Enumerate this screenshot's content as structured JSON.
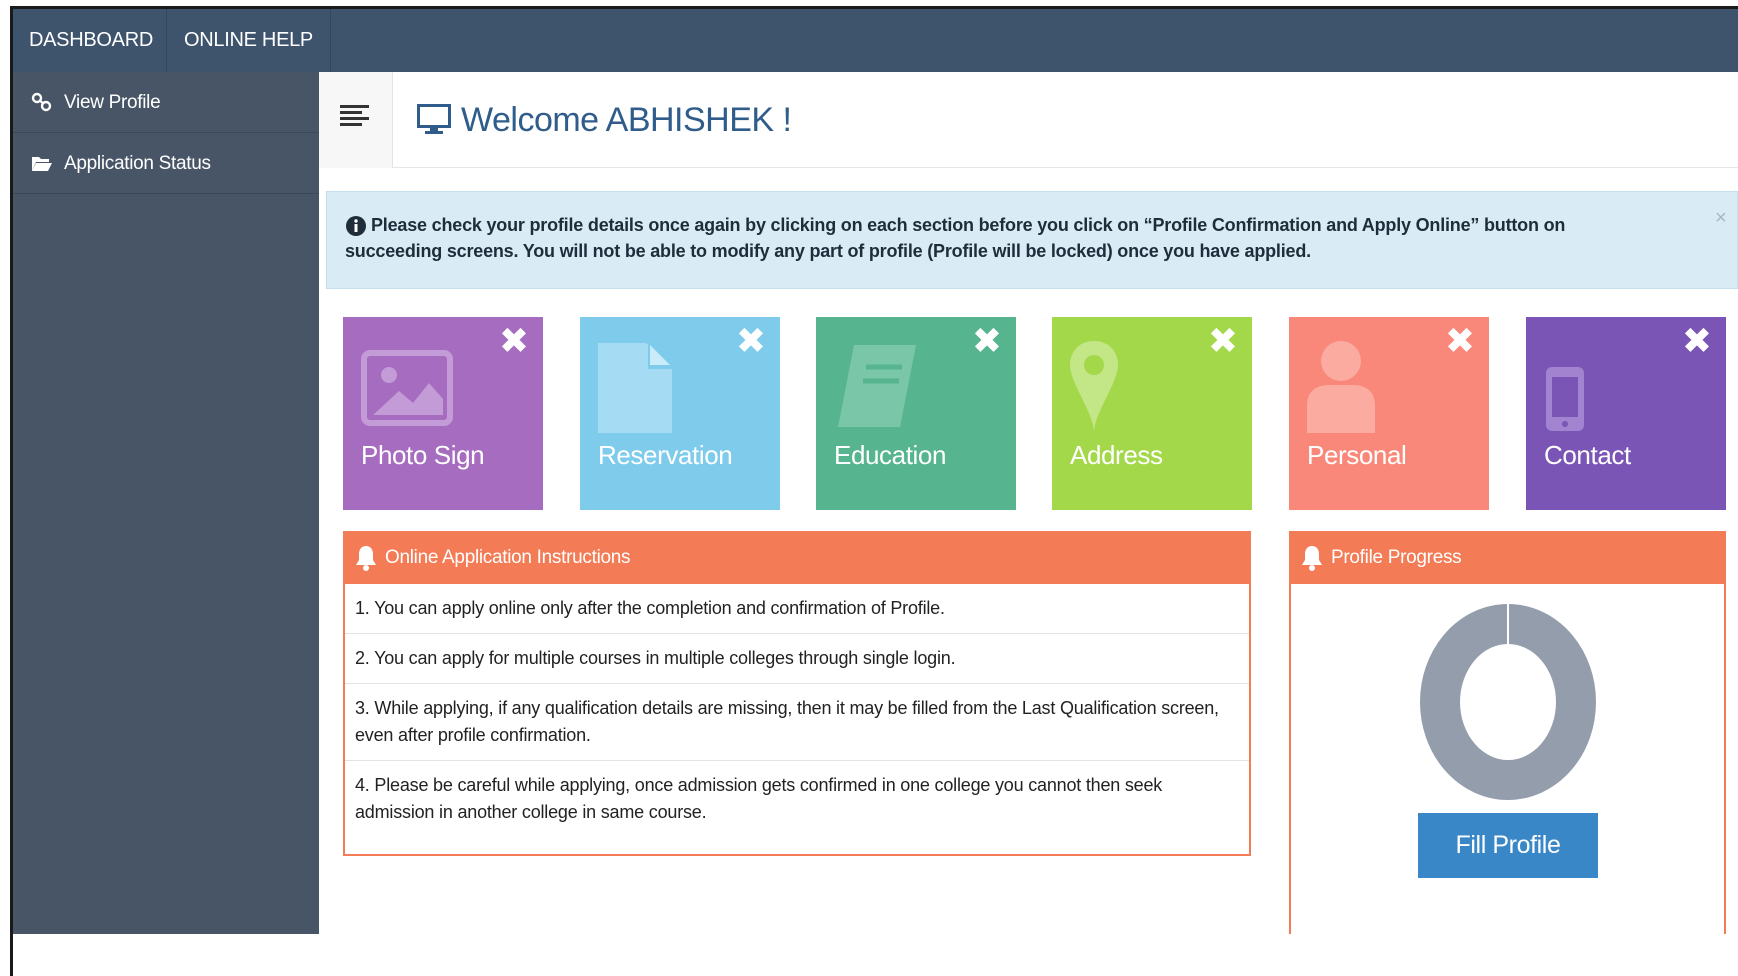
{
  "topnav": {
    "dashboard": "DASHBOARD",
    "online_help": "ONLINE HELP"
  },
  "sidebar": {
    "items": [
      {
        "label": "View Profile",
        "icon": "link-icon"
      },
      {
        "label": "Application Status",
        "icon": "folder-open-icon"
      }
    ]
  },
  "header": {
    "welcome": "Welcome ABHISHEK !",
    "icon": "monitor-icon"
  },
  "alert": {
    "text": "Please check your profile details once again by clicking on each section before you click on “Profile Confirmation and Apply Online” button on succeeding screens. You will not be able to modify any part of profile (Profile will be locked) once you have applied.",
    "close": "×"
  },
  "tiles": [
    {
      "label": "Photo Sign",
      "icon": "image-icon",
      "color": "#a66cbf",
      "status": "✖"
    },
    {
      "label": "Reservation",
      "icon": "file-icon",
      "color": "#7ecbec",
      "status": "✖"
    },
    {
      "label": "Education",
      "icon": "book-icon",
      "color": "#56b48f",
      "status": "✖"
    },
    {
      "label": "Address",
      "icon": "map-marker-icon",
      "color": "#a3d84b",
      "status": "✖"
    },
    {
      "label": "Personal",
      "icon": "user-icon",
      "color": "#f9887a",
      "status": "✖"
    },
    {
      "label": "Contact",
      "icon": "mobile-phone-icon",
      "color": "#7a55b5",
      "status": "✖"
    }
  ],
  "instructions": {
    "title": "Online Application Instructions",
    "items": [
      "1. You can apply online only after the completion and confirmation of Profile.",
      "2. You can apply for multiple courses in multiple colleges through single login.",
      "3. While applying, if any qualification details are missing, then it may be filled from the Last Qualification screen, even after profile confirmation.",
      "4. Please be careful while applying, once admission gets confirmed in one college you cannot then seek admission in another college in same course."
    ]
  },
  "progress": {
    "title": "Profile Progress",
    "completed_fraction": 0,
    "button": "Fill Profile"
  },
  "colors": {
    "topbar": "#3e536c",
    "sidebar": "#475567",
    "accent_orange": "#f37b55",
    "button_blue": "#3a87c8",
    "donut_grey": "#939dab"
  }
}
